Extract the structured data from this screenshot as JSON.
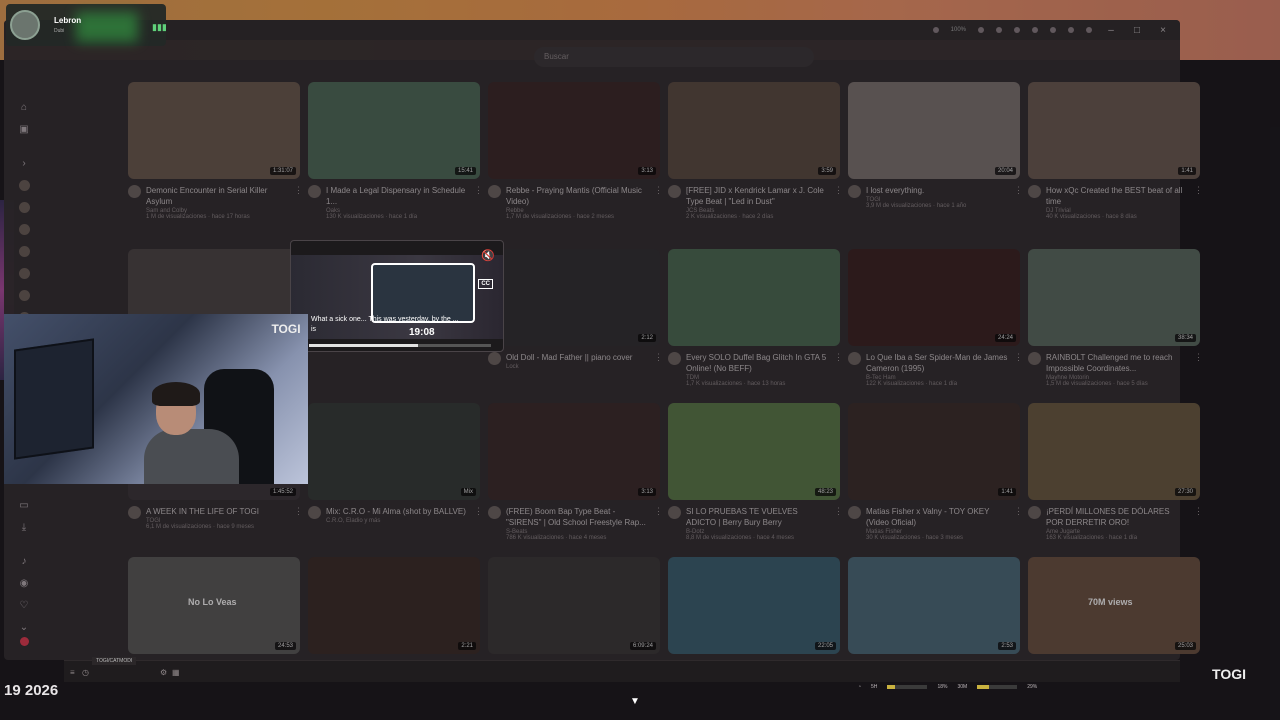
{
  "stream": {
    "name": "Lebron",
    "subtitle": "Dubi"
  },
  "search": {
    "placeholder": "Buscar"
  },
  "titlebar": {
    "zoom": "100%"
  },
  "videos": [
    {
      "title": "Demonic Encounter in Serial Killer Asylum",
      "channel": "Sam and Colby",
      "stats": "1 M de visualizaciones · hace 17 horas",
      "duration": "1:31:07",
      "color": "#6b5a4e"
    },
    {
      "title": "I Made a Legal Dispensary in Schedule 1...",
      "channel": "Oaks",
      "stats": "130 K visualizaciones · hace 1 día",
      "duration": "15:41",
      "color": "#4d6b58"
    },
    {
      "title": "Rebbe - Praying Mantis (Official Music Video)",
      "channel": "Rebbe",
      "stats": "1,7 M de visualizaciones · hace 2 meses",
      "duration": "3:13",
      "color": "#3a2626"
    },
    {
      "title": "[FREE] JID x Kendrick Lamar x J. Cole Type Beat | \"Led in Dust\"",
      "channel": "JCS Beats",
      "stats": "2 K visualizaciones · hace 2 días",
      "duration": "3:59",
      "color": "#5a4a40"
    },
    {
      "title": "I lost everything.",
      "channel": "TOGI",
      "stats": "3,9 M de visualizaciones · hace 1 año",
      "duration": "20:04",
      "color": "#7d7370"
    },
    {
      "title": "How xQc Created the BEST beat of all time",
      "channel": "DJ Trivial",
      "stats": "40 K visualizaciones · hace 8 días",
      "duration": "1:41",
      "color": "#6b5a50"
    },
    {
      "title": "",
      "channel": "",
      "stats": "",
      "duration": "",
      "color": "#4a4444"
    },
    {
      "title": "",
      "channel": "",
      "stats": "",
      "duration": "",
      "color": "#3c3a3d"
    },
    {
      "title": "Old Doll - Mad Father || piano cover",
      "channel": "Lock",
      "stats": "",
      "duration": "2:12",
      "color": "#2f2d30"
    },
    {
      "title": "Every SOLO Duffel Bag Glitch In GTA 5 Online! (No BEFF)",
      "channel": "TDM",
      "stats": "1,7 K visualizaciones · hace 13 horas",
      "duration": "",
      "color": "#4a6a52"
    },
    {
      "title": "Lo Que Iba a Ser Spider-Man de James Cameron (1995)",
      "channel": "B-Tec Ham",
      "stats": "122 K visualizaciones · hace 1 día",
      "duration": "24:24",
      "color": "#3a2020"
    },
    {
      "title": "RAINBOLT Challenged me to reach Impossible Coordinates...",
      "channel": "Mayhne Motorin",
      "stats": "1,5 M de visualizaciones · hace 5 días",
      "duration": "38:34",
      "color": "#5a6a60"
    },
    {
      "title": "A WEEK IN THE LIFE OF TOGI",
      "channel": "TOGI",
      "stats": "6,1 M de visualizaciones · hace 9 meses",
      "duration": "1:45:52",
      "color": "#3a3438"
    },
    {
      "title": "Mix: C.R.O - Mi Alma (shot by BALLVE)",
      "channel": "C.R.O, Eladio y más",
      "stats": "",
      "duration": "Mix",
      "color": "#343a36"
    },
    {
      "title": "(FREE) Boom Bap Type Beat - \"SIRENS\" | Old School Freestyle Rap...",
      "channel": "S-Beats",
      "stats": "786 K visualizaciones · hace 4 meses",
      "duration": "3:13",
      "color": "#3a2828"
    },
    {
      "title": "SI LO PRUEBAS TE VUELVES ADICTO | Berry Bury Berry",
      "channel": "B-Dotz",
      "stats": "8,8 M de visualizaciones · hace 4 meses",
      "duration": "48:23",
      "color": "#5a7a48"
    },
    {
      "title": "Matias Fisher x Valny - TOY OKEY (Video Oficial)",
      "channel": "Matias Fisher",
      "stats": "30 K visualizaciones · hace 3 meses",
      "duration": "1:41",
      "color": "#3a2c28"
    },
    {
      "title": "¡PERDÍ MILLONES DE DÓLARES POR DERRETIR ORO!",
      "channel": "Ame Jugarte",
      "stats": "163 K visualizaciones · hace 1 día",
      "duration": "27:30",
      "color": "#6a5a40"
    },
    {
      "title": "",
      "channel": "",
      "stats": "",
      "duration": "24:53",
      "color": "#5a5a58",
      "thumb_text": "No Lo Veas"
    },
    {
      "title": "",
      "channel": "",
      "stats": "",
      "duration": "2:21",
      "color": "#3a2a26"
    },
    {
      "title": "",
      "channel": "",
      "stats": "",
      "duration": "6:09:24",
      "color": "#3a3636"
    },
    {
      "title": "",
      "channel": "",
      "stats": "",
      "duration": "22:05",
      "color": "#3a6070"
    },
    {
      "title": "",
      "channel": "",
      "stats": "",
      "duration": "2:53",
      "color": "#4a6a7a"
    },
    {
      "title": "",
      "channel": "",
      "stats": "",
      "duration": "25:03",
      "color": "#6a5040",
      "thumb_text": "70M views"
    }
  ],
  "preview": {
    "caption": "What a sick one... This was yesterday, by the ... is",
    "time": "19:08",
    "cc": "CC",
    "progress_fraction": 0.6
  },
  "webcam": {
    "logo_text": "TOGI"
  },
  "bottom": {
    "tag": "TOGI/CATMODI",
    "date": "19 2026",
    "cpu_label": "5H",
    "cpu_value": "18%",
    "cpu_fraction": 0.18,
    "gpu_label": "30M",
    "gpu_value": "29%",
    "gpu_fraction": 0.29
  },
  "corner_logo": "TOGI",
  "colors": {
    "accent_red": "#e53950",
    "bg": "#17151a"
  }
}
